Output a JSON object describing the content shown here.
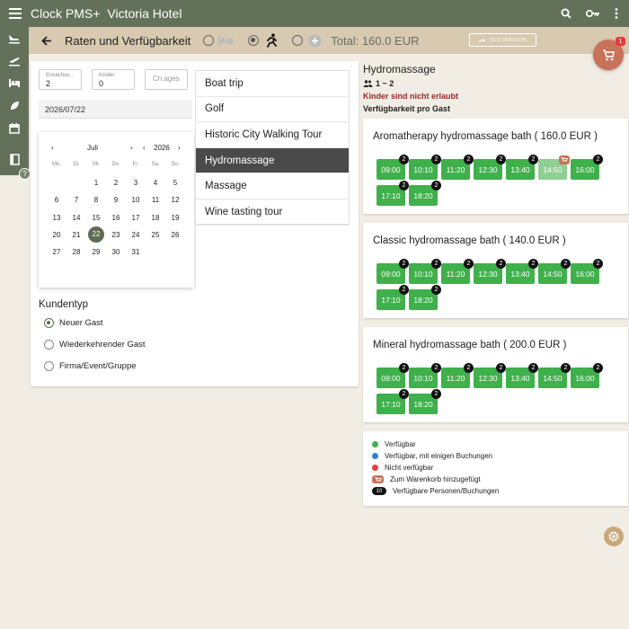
{
  "app": {
    "brand": "Clock PMS+",
    "hotel": "Victoria Hotel"
  },
  "header": {
    "title": "Raten und Verfügbarkeit",
    "total": "Total: 160.0 EUR",
    "old_version": "OLD VERSION",
    "cart_count": "1"
  },
  "booking": {
    "adults_label": "Erwachse...",
    "adults_value": "2",
    "children_label": "Kinder",
    "children_value": "0",
    "ch_ages_placeholder": "Ch.ages",
    "date": "2026/07/22"
  },
  "calendar": {
    "month": "Juli",
    "year": "2026",
    "weekdays": [
      "Mo.",
      "Di.",
      "Mi.",
      "Do.",
      "Fr.",
      "Sa.",
      "So."
    ],
    "weeks": [
      [
        "",
        "",
        "1",
        "2",
        "3",
        "4",
        "5"
      ],
      [
        "6",
        "7",
        "8",
        "9",
        "10",
        "11",
        "12"
      ],
      [
        "13",
        "14",
        "15",
        "16",
        "17",
        "18",
        "19"
      ],
      [
        "20",
        "21",
        "22",
        "23",
        "24",
        "25",
        "26"
      ],
      [
        "27",
        "28",
        "29",
        "30",
        "31",
        "",
        ""
      ]
    ],
    "selected": "22"
  },
  "activities": [
    "Boat trip",
    "Golf",
    "Historic City Walking Tour",
    "Hydromassage",
    "Massage",
    "Wine tasting tour"
  ],
  "active_activity": "Hydromassage",
  "customer": {
    "title": "Kundentyp",
    "options": [
      "Neuer Gast",
      "Wiederkehrender Gast",
      "Firma/Event/Gruppe"
    ],
    "selected": "Neuer Gast"
  },
  "detail": {
    "title": "Hydromassage",
    "persons": "1 ~ 2",
    "warning": "Kinder sind nicht erlaubt",
    "availability": "Verfügbarkeit pro Gast"
  },
  "services": [
    {
      "name": "Aromatherapy hydromassage bath ( 160.0 EUR )",
      "slots": [
        {
          "time": "09:00",
          "count": "2",
          "state": "available"
        },
        {
          "time": "10:10",
          "count": "2",
          "state": "available"
        },
        {
          "time": "11:20",
          "count": "2",
          "state": "available"
        },
        {
          "time": "12:30",
          "count": "2",
          "state": "available"
        },
        {
          "time": "13:40",
          "count": "2",
          "state": "available"
        },
        {
          "time": "14:50",
          "count": "",
          "state": "in-cart"
        },
        {
          "time": "16:00",
          "count": "2",
          "state": "available"
        },
        {
          "time": "17:10",
          "count": "2",
          "state": "available"
        },
        {
          "time": "18:20",
          "count": "2",
          "state": "available"
        }
      ]
    },
    {
      "name": "Classic hydromassage bath ( 140.0 EUR )",
      "slots": [
        {
          "time": "09:00",
          "count": "2",
          "state": "available"
        },
        {
          "time": "10:10",
          "count": "2",
          "state": "available"
        },
        {
          "time": "11:20",
          "count": "2",
          "state": "available"
        },
        {
          "time": "12:30",
          "count": "2",
          "state": "available"
        },
        {
          "time": "13:40",
          "count": "2",
          "state": "available"
        },
        {
          "time": "14:50",
          "count": "2",
          "state": "available"
        },
        {
          "time": "16:00",
          "count": "2",
          "state": "available"
        },
        {
          "time": "17:10",
          "count": "2",
          "state": "available"
        },
        {
          "time": "18:20",
          "count": "2",
          "state": "available"
        }
      ]
    },
    {
      "name": "Mineral hydromassage bath ( 200.0 EUR )",
      "slots": [
        {
          "time": "09:00",
          "count": "2",
          "state": "available"
        },
        {
          "time": "10:10",
          "count": "2",
          "state": "available"
        },
        {
          "time": "11:20",
          "count": "2",
          "state": "available"
        },
        {
          "time": "12:30",
          "count": "2",
          "state": "available"
        },
        {
          "time": "13:40",
          "count": "2",
          "state": "available"
        },
        {
          "time": "14:50",
          "count": "2",
          "state": "available"
        },
        {
          "time": "16:00",
          "count": "2",
          "state": "available"
        },
        {
          "time": "17:10",
          "count": "2",
          "state": "available"
        },
        {
          "time": "18:20",
          "count": "2",
          "state": "available"
        }
      ]
    }
  ],
  "legend": {
    "available": "Verfügbar",
    "partial": "Verfügbar, mit einigen Buchungen",
    "unavailable": "Nicht verfügbar",
    "in_cart": "Zum Warenkorb hinzugefügt",
    "badge_example": "10",
    "capacity": "Verfügbare Personen/Buchungen"
  },
  "colors": {
    "primary": "#64715a",
    "accent_bar": "#d8cab0",
    "background": "#f1ece4",
    "available": "#3fb04b",
    "partial": "#2f84c8",
    "unavailable": "#e04040",
    "cart": "#c9725a"
  },
  "icons": {
    "menu": "menu-icon",
    "search": "search-icon",
    "key": "key-icon",
    "more": "more-vert-icon",
    "back": "arrow-back-icon",
    "cart": "cart-icon",
    "settings": "gear-icon"
  }
}
